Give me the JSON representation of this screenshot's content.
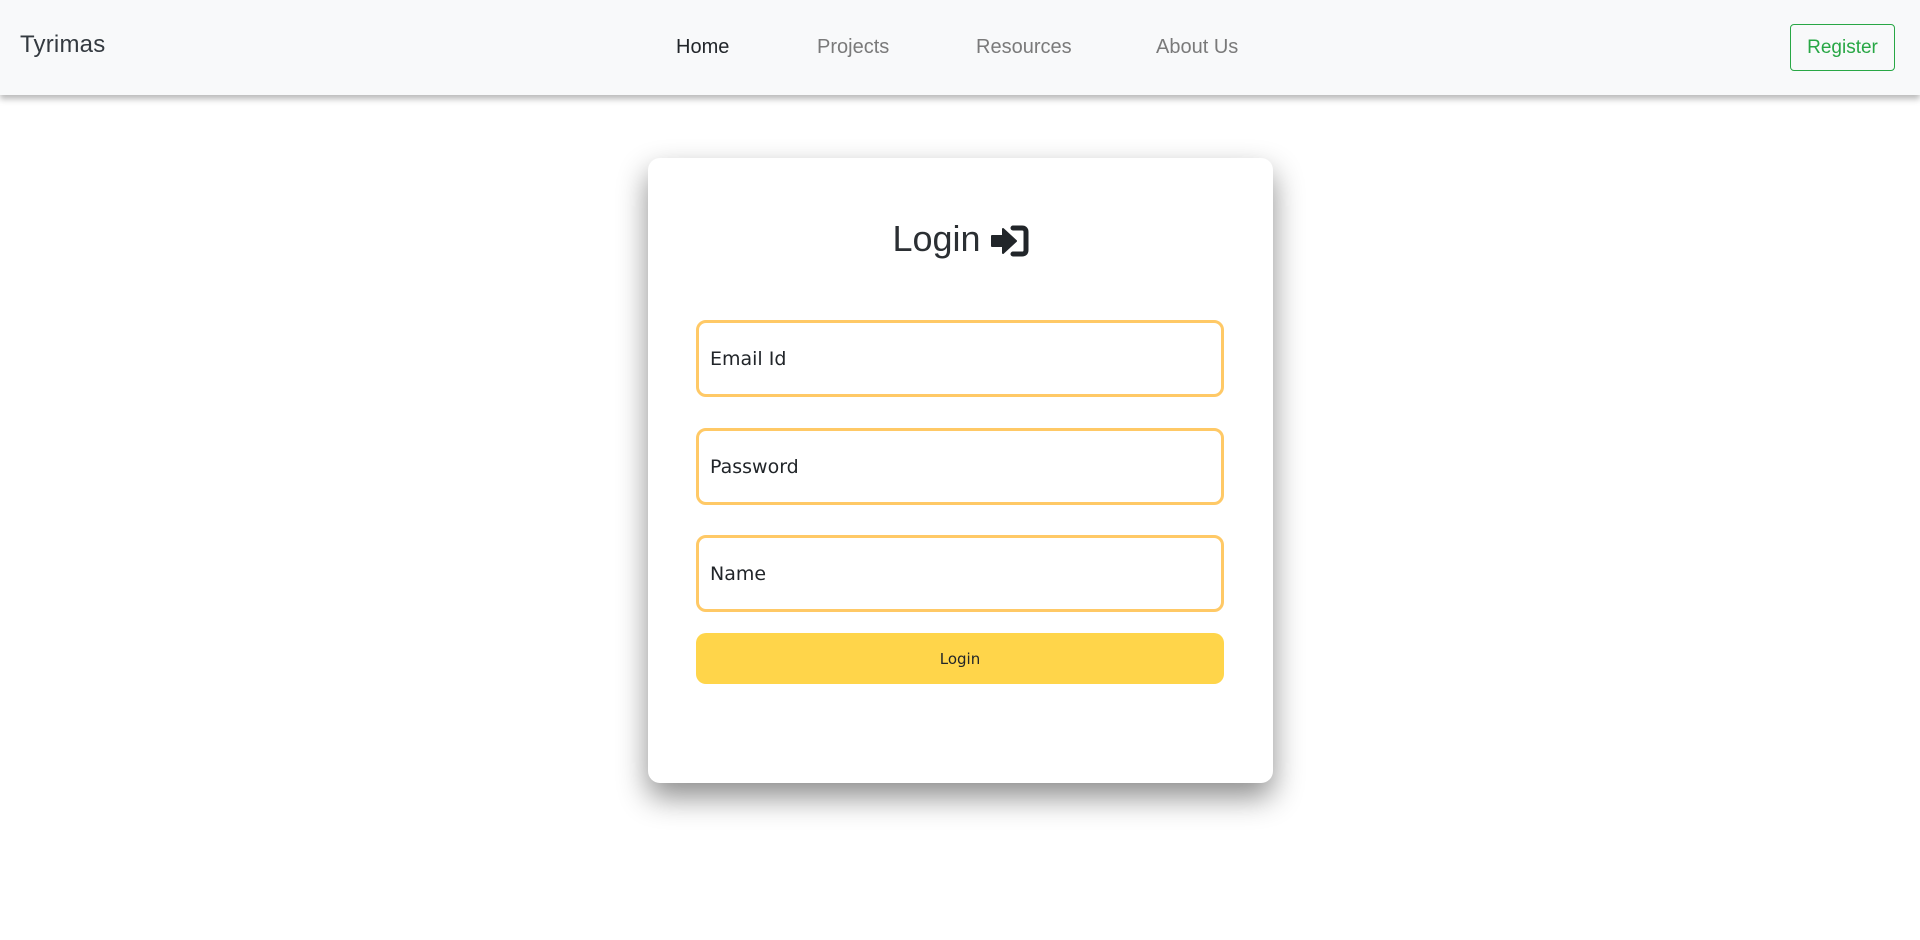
{
  "navbar": {
    "brand": "Tyrimas",
    "links": [
      {
        "label": "Home",
        "active": true
      },
      {
        "label": "Projects",
        "active": false
      },
      {
        "label": "Resources",
        "active": false
      },
      {
        "label": "About Us",
        "active": false
      }
    ],
    "register_label": "Register"
  },
  "login_card": {
    "title": "Login",
    "title_icon": "sign-in-icon",
    "fields": {
      "email_placeholder": "Email Id",
      "password_placeholder": "Password",
      "name_placeholder": "Name",
      "email_value": "",
      "password_value": "",
      "name_value": ""
    },
    "submit_label": "Login"
  },
  "colors": {
    "navbar_bg": "#f8f9fa",
    "register_accent": "#28a745",
    "field_border": "#ffc966",
    "button_bg": "#ffd54a",
    "text_dark": "#212529",
    "nav_inactive": "#7a7a7a"
  }
}
